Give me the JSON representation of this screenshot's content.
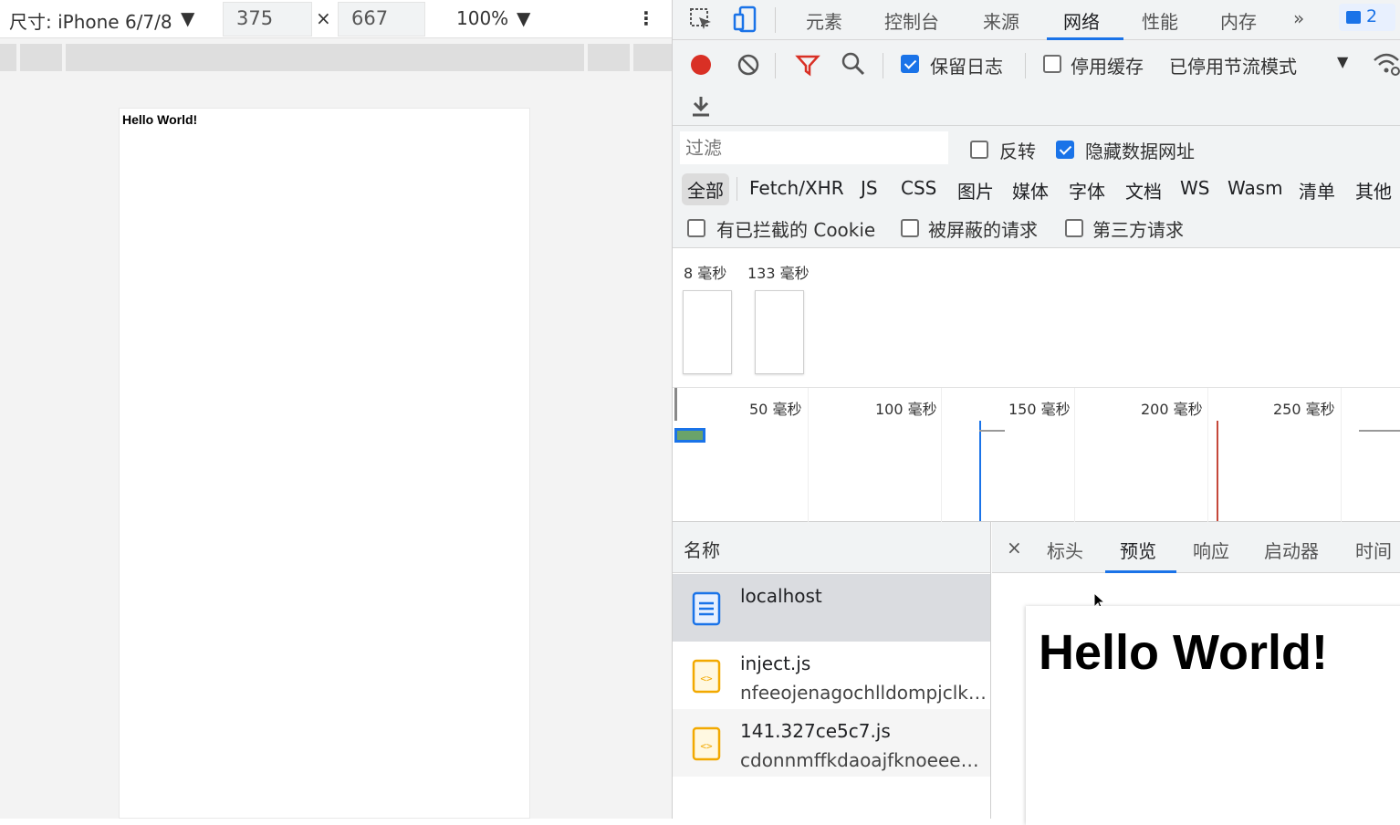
{
  "device_toolbar": {
    "device_label": "尺寸: iPhone 6/7/8",
    "width": "375",
    "times": "×",
    "height": "667",
    "zoom": "100%"
  },
  "page_preview": {
    "text": "Hello World!"
  },
  "devtools": {
    "tabs": [
      "元素",
      "控制台",
      "来源",
      "网络",
      "性能",
      "内存"
    ],
    "active_tab": "网络",
    "more": "»",
    "issues_count": "2",
    "toolbar": {
      "preserve_log": "保留日志",
      "disable_cache": "停用缓存",
      "throttling": "已停用节流模式"
    },
    "filter": {
      "placeholder": "过滤",
      "invert": "反转",
      "hide_data_urls": "隐藏数据网址",
      "types": [
        "全部",
        "Fetch/XHR",
        "JS",
        "CSS",
        "图片",
        "媒体",
        "字体",
        "文档",
        "WS",
        "Wasm",
        "清单",
        "其他"
      ],
      "blocked_cookies": "有已拦截的 Cookie",
      "blocked_requests": "被屏蔽的请求",
      "third_party": "第三方请求"
    },
    "overview": {
      "frames": [
        "8 毫秒",
        "133 毫秒"
      ]
    },
    "timeline": {
      "ticks": [
        "50 毫秒",
        "100 毫秒",
        "150 毫秒",
        "200 毫秒",
        "250 毫秒"
      ]
    },
    "requests": {
      "column": "名称",
      "rows": [
        {
          "name": "localhost",
          "domain": ""
        },
        {
          "name": "inject.js",
          "domain": "nfeeojenagochlldompjclk…"
        },
        {
          "name": "141.327ce5c7.js",
          "domain": "cdonnmffkdaoajfknoeeec…"
        }
      ]
    },
    "detail": {
      "close": "×",
      "tabs": [
        "标头",
        "预览",
        "响应",
        "启动器",
        "时间"
      ],
      "active": "预览",
      "preview_text": "Hello World!"
    }
  },
  "colors": {
    "accent": "#1a73e8",
    "record": "#d93025",
    "filter_icon": "#d93025",
    "js_icon": "#f2a900"
  }
}
